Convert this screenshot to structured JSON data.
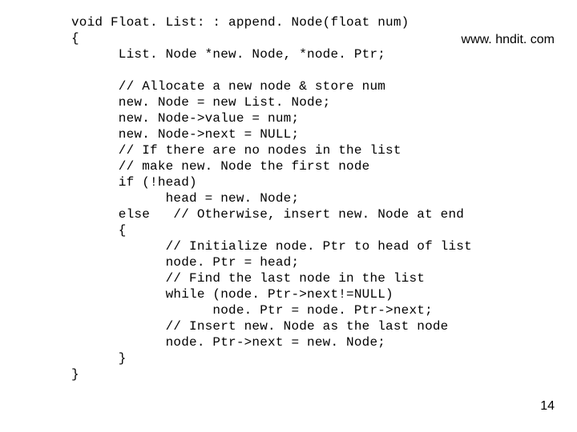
{
  "watermark": "www. hndit. com",
  "page_number": "14",
  "code": {
    "l01": "void Float. List: : append. Node(float num)",
    "l02": "{",
    "l03": "      List. Node *new. Node, *node. Ptr;",
    "l04": "",
    "l05": "      // Allocate a new node & store num",
    "l06": "      new. Node = new List. Node;",
    "l07": "      new. Node->value = num;",
    "l08": "      new. Node->next = NULL;",
    "l09": "      // If there are no nodes in the list",
    "l10": "      // make new. Node the first node",
    "l11": "      if (!head)",
    "l12": "            head = new. Node;",
    "l13": "      else   // Otherwise, insert new. Node at end",
    "l14": "      {",
    "l15": "            // Initialize node. Ptr to head of list",
    "l16": "            node. Ptr = head;",
    "l17": "            // Find the last node in the list",
    "l18": "            while (node. Ptr->next!=NULL)",
    "l19": "                  node. Ptr = node. Ptr->next;",
    "l20": "            // Insert new. Node as the last node",
    "l21": "            node. Ptr->next = new. Node;",
    "l22": "      }",
    "l23": "}"
  }
}
